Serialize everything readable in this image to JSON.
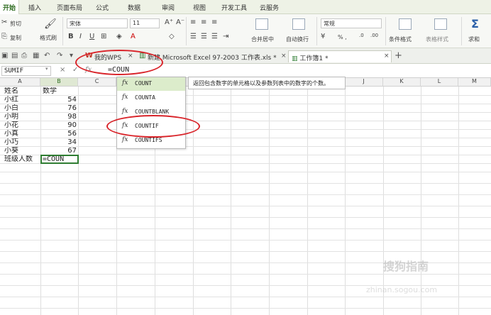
{
  "menu_tabs": [
    "开始",
    "插入",
    "页面布局",
    "公式",
    "数据",
    "审阅",
    "视图",
    "开发工具",
    "云服务"
  ],
  "ribbon": {
    "cut": "剪切",
    "copy": "复制",
    "format_painter": "格式刷",
    "font_name": "宋体",
    "font_size": "11",
    "merge_center": "合并居中",
    "wrap_text": "自动换行",
    "number_format": "常规",
    "percent_group": "% ,",
    "conditional_format": "条件格式",
    "table_style": "表格样式",
    "sum": "求和"
  },
  "doc_tabs": [
    {
      "label": "我的WPS",
      "active": false
    },
    {
      "label": "新建 Microsoft Excel 97-2003 工作表.xls *",
      "active": false
    },
    {
      "label": "工作簿1 *",
      "active": true
    }
  ],
  "formula_bar": {
    "name_box": "SUMIF",
    "cancel": "×",
    "accept": "✓",
    "fx": "fx",
    "formula": "=COUN"
  },
  "columns": [
    "A",
    "B",
    "C",
    "D",
    "E",
    "F",
    "G",
    "H",
    "I",
    "J",
    "K",
    "L",
    "M"
  ],
  "active_column": "B",
  "rows": [
    [
      "姓名",
      "数学"
    ],
    [
      "小红",
      "54"
    ],
    [
      "小白",
      "76"
    ],
    [
      "小明",
      "98"
    ],
    [
      "小花",
      "90"
    ],
    [
      "小真",
      "56"
    ],
    [
      "小巧",
      "34"
    ],
    [
      "小葵",
      "67"
    ],
    [
      "班级人数",
      "=COUN"
    ]
  ],
  "autocomplete": {
    "items": [
      "COUNT",
      "COUNTA",
      "COUNTBLANK",
      "COUNTIF",
      "COUNTIFS"
    ],
    "selected_index": 0,
    "tooltip": "返回包含数字的单元格以及参数列表中的数字的个数。"
  },
  "watermark": {
    "brand": "搜狗指南",
    "url": "zhinan.sogou.com"
  },
  "colors": {
    "accent_green": "#2d6b1f",
    "selection_green": "#dceccb",
    "annotation_red": "#d9242a"
  }
}
